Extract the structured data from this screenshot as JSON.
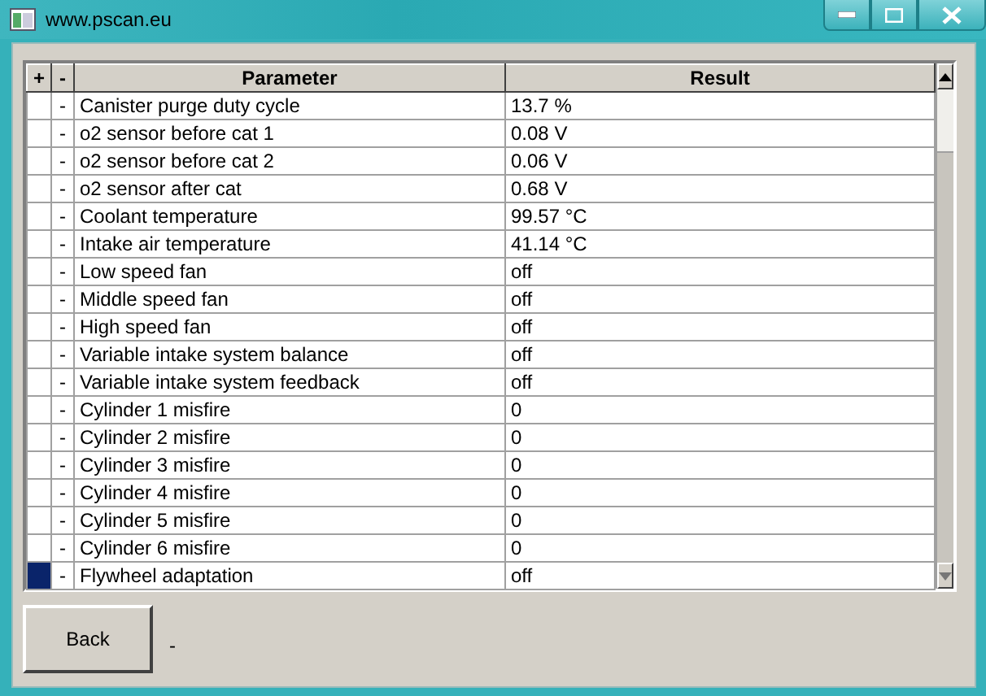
{
  "window": {
    "title": "www.pscan.eu"
  },
  "table": {
    "columns": [
      "+",
      "-",
      "Parameter",
      "Result"
    ],
    "rows": [
      {
        "marker": "-",
        "parameter": "Canister purge duty cycle",
        "result": "13.7 %",
        "selected": false
      },
      {
        "marker": "-",
        "parameter": "o2 sensor before cat 1",
        "result": "0.08 V",
        "selected": false
      },
      {
        "marker": "-",
        "parameter": "o2 sensor before cat 2",
        "result": "0.06 V",
        "selected": false
      },
      {
        "marker": "-",
        "parameter": "o2 sensor after cat",
        "result": "0.68 V",
        "selected": false
      },
      {
        "marker": "-",
        "parameter": "Coolant temperature",
        "result": "99.57 °C",
        "selected": false
      },
      {
        "marker": "-",
        "parameter": "Intake air temperature",
        "result": "41.14 °C",
        "selected": false
      },
      {
        "marker": "-",
        "parameter": "Low speed fan",
        "result": "off",
        "selected": false
      },
      {
        "marker": "-",
        "parameter": "Middle speed fan",
        "result": "off",
        "selected": false
      },
      {
        "marker": "-",
        "parameter": "High speed fan",
        "result": "off",
        "selected": false
      },
      {
        "marker": "-",
        "parameter": "Variable intake system balance",
        "result": "off",
        "selected": false
      },
      {
        "marker": "-",
        "parameter": "Variable intake system feedback",
        "result": "off",
        "selected": false
      },
      {
        "marker": "-",
        "parameter": "Cylinder 1 misfire",
        "result": "0",
        "selected": false
      },
      {
        "marker": "-",
        "parameter": "Cylinder 2 misfire",
        "result": "0",
        "selected": false
      },
      {
        "marker": "-",
        "parameter": "Cylinder 3 misfire",
        "result": "0",
        "selected": false
      },
      {
        "marker": "-",
        "parameter": "Cylinder 4 misfire",
        "result": "0",
        "selected": false
      },
      {
        "marker": "-",
        "parameter": "Cylinder 5 misfire",
        "result": "0",
        "selected": false
      },
      {
        "marker": "-",
        "parameter": "Cylinder 6 misfire",
        "result": "0",
        "selected": false
      },
      {
        "marker": "-",
        "parameter": "Flywheel adaptation",
        "result": "off",
        "selected": true
      }
    ]
  },
  "footer": {
    "button": "Back",
    "status": "-"
  }
}
